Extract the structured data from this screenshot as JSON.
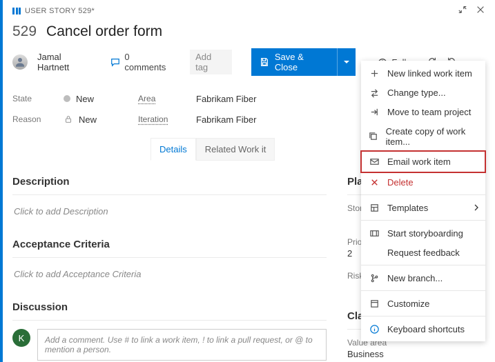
{
  "breadcrumb": {
    "text": "USER STORY 529*"
  },
  "title": {
    "id": "529",
    "text": "Cancel order form"
  },
  "assignee": {
    "name": "Jamal Hartnett"
  },
  "comments": {
    "count_label": "0 comments"
  },
  "add_tag_label": "Add tag",
  "save_button_label": "Save & Close",
  "follow_label": "Follow",
  "fields": {
    "state_label": "State",
    "state_value": "New",
    "reason_label": "Reason",
    "reason_value": "New",
    "area_label": "Area",
    "area_value": "Fabrikam Fiber",
    "iteration_label": "Iteration",
    "iteration_value": "Fabrikam Fiber"
  },
  "tabs": {
    "details": "Details",
    "related": "Related Work it"
  },
  "left": {
    "description_h": "Description",
    "description_ph": "Click to add Description",
    "acceptance_h": "Acceptance Criteria",
    "acceptance_ph": "Click to add Acceptance Criteria",
    "discussion_h": "Discussion",
    "discussion_avatar": "K",
    "discussion_ph": "Add a comment. Use # to link a work item, ! to link a pull request, or @ to mention a person."
  },
  "right": {
    "planning_h": "Planning",
    "story_points_label": "Story Points",
    "priority_label": "Priority",
    "priority_value": "2",
    "risk_label": "Risk",
    "classification_h": "Classificati",
    "value_area_label": "Value area",
    "value_area_value": "Business"
  },
  "menu": {
    "new_linked": "New linked work item",
    "change_type": "Change type...",
    "move_team": "Move to team project",
    "create_copy": "Create copy of work item...",
    "email": "Email work item",
    "delete": "Delete",
    "templates": "Templates",
    "storyboarding": "Start storyboarding",
    "feedback": "Request feedback",
    "new_branch": "New branch...",
    "customize": "Customize",
    "shortcuts": "Keyboard shortcuts"
  }
}
